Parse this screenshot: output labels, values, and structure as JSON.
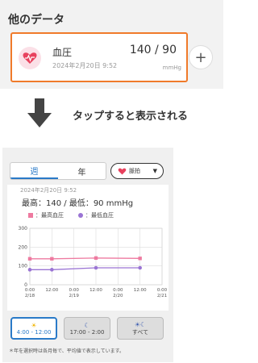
{
  "top": {
    "section_title": "他のデータ",
    "card": {
      "label": "血圧",
      "date": "2024年2月20日 9:52",
      "value": "140 / 90",
      "unit": "mmHg"
    },
    "add_symbol": "+"
  },
  "caption": "タップすると表示される",
  "screen": {
    "tabs": [
      {
        "label": "週",
        "selected": true
      },
      {
        "label": "年",
        "selected": false
      }
    ],
    "pulse_dropdown": {
      "label": "脈拍",
      "caret": "▼"
    },
    "chart_header": {
      "date": "2024年2月20日 9:52",
      "summary": "最高：140 / 最低：90 mmHg"
    },
    "legend": [
      {
        "label": "：最高血圧",
        "color": "#ee7aa0"
      },
      {
        "label": "：最低血圧",
        "color": "#9a74d4"
      }
    ],
    "time_buttons": [
      {
        "icon": "☀",
        "label": "4:00 - 12:00",
        "active": true
      },
      {
        "icon": "☾",
        "label": "17:00 - 2:00",
        "active": false
      },
      {
        "icon": "☀☾",
        "label": "すべて",
        "active": false
      }
    ],
    "footnote": "＊年を選択時は各月毎で、平均値で表示しています。"
  },
  "chart_data": {
    "type": "line",
    "x_ticks": [
      {
        "time": "0:00",
        "date": "2/18",
        "h": 0
      },
      {
        "time": "12:00",
        "date": "",
        "h": 12
      },
      {
        "time": "0:00",
        "date": "2/19",
        "h": 24
      },
      {
        "time": "12:00",
        "date": "",
        "h": 36
      },
      {
        "time": "0:00",
        "date": "2/20",
        "h": 48
      },
      {
        "time": "12:00",
        "date": "",
        "h": 60
      },
      {
        "time": "0:00",
        "date": "2/21",
        "h": 72
      }
    ],
    "y_ticks": [
      0,
      100,
      200,
      300
    ],
    "ylim": [
      0,
      300
    ],
    "xlim": [
      0,
      72
    ],
    "series": [
      {
        "name": "最高血圧",
        "color": "#ee7aa0",
        "marker": "square",
        "points": [
          [
            0,
            138
          ],
          [
            12,
            138
          ],
          [
            36,
            142
          ],
          [
            60,
            140
          ]
        ]
      },
      {
        "name": "最低血圧",
        "color": "#9a74d4",
        "marker": "circle",
        "points": [
          [
            0,
            80
          ],
          [
            12,
            80
          ],
          [
            36,
            90
          ],
          [
            60,
            90
          ]
        ]
      }
    ]
  },
  "colors": {
    "highlight": "#f07a2a",
    "accent": "#2a7ac8",
    "heart": "#e8415d"
  }
}
